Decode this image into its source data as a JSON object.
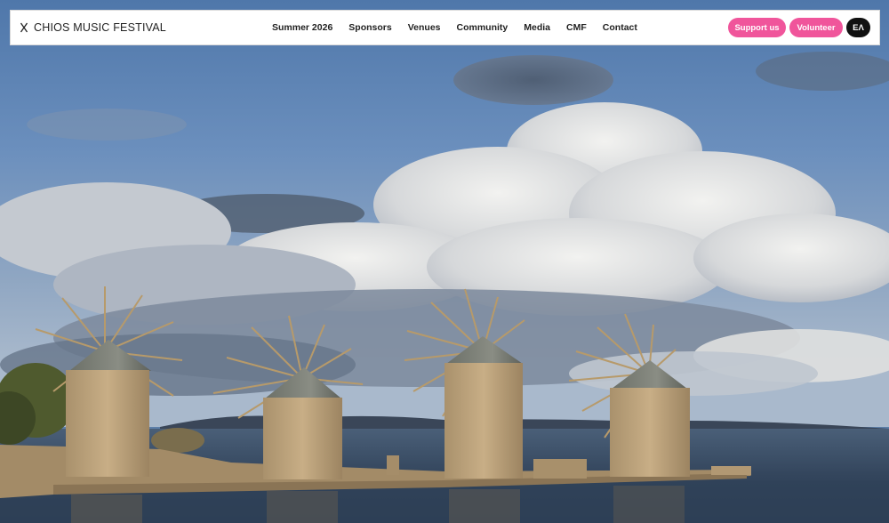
{
  "brand": {
    "name": "CHIOS MUSIC FESTIVAL",
    "icon": "x-logo-icon"
  },
  "nav": {
    "items": [
      {
        "label": "Summer 2026"
      },
      {
        "label": "Sponsors"
      },
      {
        "label": "Venues"
      },
      {
        "label": "Community"
      },
      {
        "label": "Media"
      },
      {
        "label": "CMF"
      },
      {
        "label": "Contact"
      }
    ]
  },
  "actions": {
    "support_label": "Support us",
    "volunteer_label": "Volunteer",
    "language_label": "ΕΛ"
  },
  "colors": {
    "accent_pink": "#f0559b",
    "lang_button": "#111111",
    "nav_background": "#ffffff"
  }
}
